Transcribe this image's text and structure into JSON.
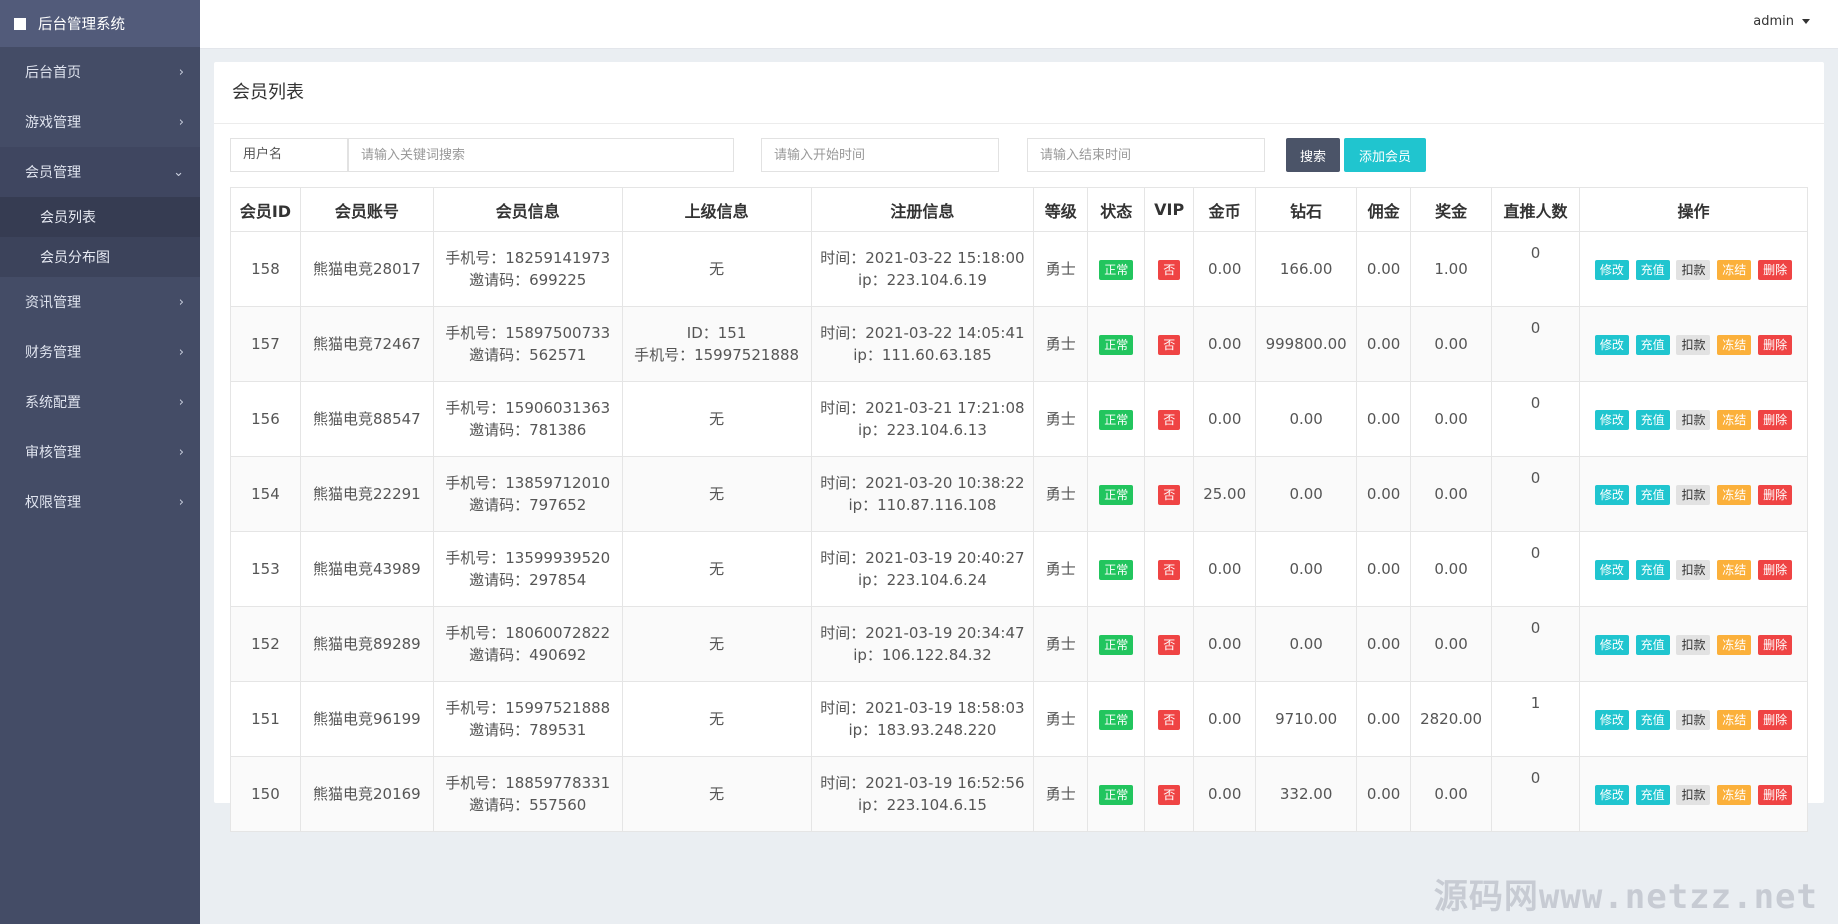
{
  "brand": {
    "title": "后台管理系统"
  },
  "sidebar": {
    "items": [
      {
        "label": "后台首页"
      },
      {
        "label": "游戏管理"
      },
      {
        "label": "会员管理",
        "open": true,
        "children": [
          {
            "label": "会员列表",
            "active": true
          },
          {
            "label": "会员分布图"
          }
        ]
      },
      {
        "label": "资讯管理"
      },
      {
        "label": "财务管理"
      },
      {
        "label": "系统配置"
      },
      {
        "label": "审核管理"
      },
      {
        "label": "权限管理"
      }
    ]
  },
  "topbar": {
    "user": "admin"
  },
  "panel": {
    "title": "会员列表"
  },
  "search": {
    "field_label": "用户名",
    "keyword_placeholder": "请输入关键词搜索",
    "start_placeholder": "请输入开始时间",
    "end_placeholder": "请输入结束时间",
    "search_label": "搜索",
    "add_label": "添加会员"
  },
  "table": {
    "headers": [
      "会员ID",
      "会员账号",
      "会员信息",
      "上级信息",
      "注册信息",
      "等级",
      "状态",
      "VIP",
      "金币",
      "钻石",
      "佣金",
      "奖金",
      "直推人数",
      "操作"
    ],
    "actions": [
      "修改",
      "充值",
      "扣款",
      "冻结",
      "删除"
    ],
    "rows": [
      {
        "id": "158",
        "account": "熊猫电竞28017",
        "phone": "手机号：18259141973",
        "invite": "邀请码：699225",
        "parent1": "无",
        "parent2": "",
        "time": "时间：2021-03-22 15:18:00",
        "ip": "ip：223.104.6.19",
        "level": "勇士",
        "status": "正常",
        "vip": "否",
        "gold": "0.00",
        "diamond": "166.00",
        "commission": "0.00",
        "bonus": "1.00",
        "referrals": "0"
      },
      {
        "id": "157",
        "account": "熊猫电竞72467",
        "phone": "手机号：15897500733",
        "invite": "邀请码：562571",
        "parent1": "ID：151",
        "parent2": "手机号：15997521888",
        "time": "时间：2021-03-22 14:05:41",
        "ip": "ip：111.60.63.185",
        "level": "勇士",
        "status": "正常",
        "vip": "否",
        "gold": "0.00",
        "diamond": "999800.00",
        "commission": "0.00",
        "bonus": "0.00",
        "referrals": "0"
      },
      {
        "id": "156",
        "account": "熊猫电竞88547",
        "phone": "手机号：15906031363",
        "invite": "邀请码：781386",
        "parent1": "无",
        "parent2": "",
        "time": "时间：2021-03-21 17:21:08",
        "ip": "ip：223.104.6.13",
        "level": "勇士",
        "status": "正常",
        "vip": "否",
        "gold": "0.00",
        "diamond": "0.00",
        "commission": "0.00",
        "bonus": "0.00",
        "referrals": "0"
      },
      {
        "id": "154",
        "account": "熊猫电竞22291",
        "phone": "手机号：13859712010",
        "invite": "邀请码：797652",
        "parent1": "无",
        "parent2": "",
        "time": "时间：2021-03-20 10:38:22",
        "ip": "ip：110.87.116.108",
        "level": "勇士",
        "status": "正常",
        "vip": "否",
        "gold": "25.00",
        "diamond": "0.00",
        "commission": "0.00",
        "bonus": "0.00",
        "referrals": "0"
      },
      {
        "id": "153",
        "account": "熊猫电竞43989",
        "phone": "手机号：13599939520",
        "invite": "邀请码：297854",
        "parent1": "无",
        "parent2": "",
        "time": "时间：2021-03-19 20:40:27",
        "ip": "ip：223.104.6.24",
        "level": "勇士",
        "status": "正常",
        "vip": "否",
        "gold": "0.00",
        "diamond": "0.00",
        "commission": "0.00",
        "bonus": "0.00",
        "referrals": "0"
      },
      {
        "id": "152",
        "account": "熊猫电竞89289",
        "phone": "手机号：18060072822",
        "invite": "邀请码：490692",
        "parent1": "无",
        "parent2": "",
        "time": "时间：2021-03-19 20:34:47",
        "ip": "ip：106.122.84.32",
        "level": "勇士",
        "status": "正常",
        "vip": "否",
        "gold": "0.00",
        "diamond": "0.00",
        "commission": "0.00",
        "bonus": "0.00",
        "referrals": "0"
      },
      {
        "id": "151",
        "account": "熊猫电竞96199",
        "phone": "手机号：15997521888",
        "invite": "邀请码：789531",
        "parent1": "无",
        "parent2": "",
        "time": "时间：2021-03-19 18:58:03",
        "ip": "ip：183.93.248.220",
        "level": "勇士",
        "status": "正常",
        "vip": "否",
        "gold": "0.00",
        "diamond": "9710.00",
        "commission": "0.00",
        "bonus": "2820.00",
        "referrals": "1"
      },
      {
        "id": "150",
        "account": "熊猫电竞20169",
        "phone": "手机号：18859778331",
        "invite": "邀请码：557560",
        "parent1": "无",
        "parent2": "",
        "time": "时间：2021-03-19 16:52:56",
        "ip": "ip：223.104.6.15",
        "level": "勇士",
        "status": "正常",
        "vip": "否",
        "gold": "0.00",
        "diamond": "332.00",
        "commission": "0.00",
        "bonus": "0.00",
        "referrals": "0"
      }
    ]
  },
  "watermark": "源码网www.netzz.net"
}
